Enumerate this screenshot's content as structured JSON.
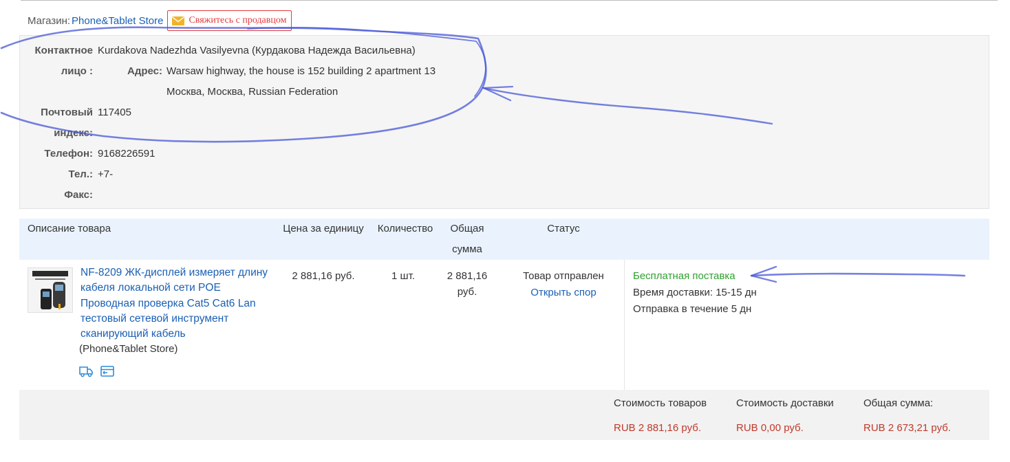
{
  "store": {
    "label": "Магазин:",
    "name": "Phone&Tablet Store",
    "contact_button": "Свяжитесь с продавцом"
  },
  "address": {
    "contact_label_1": "Контактное",
    "contact_label_2": "лицо :",
    "contact_value": "Kurdakova Nadezhda Vasilyevna (Курдакова Надежда Васильевна)",
    "address_label": "Адрес:",
    "address_line1": "Warsaw highway, the house is 152 building 2 apartment 13",
    "address_line2": "Москва, Москва, Russian Federation",
    "postal_label_1": "Почтовый",
    "postal_label_2": "индекс:",
    "postal_value": "117405",
    "phone_label": "Телефон:",
    "phone_value": "9168226591",
    "tel_label": "Тел.:",
    "tel_value": "+7-",
    "fax_label": "Факс:",
    "fax_value": ""
  },
  "table": {
    "headers": {
      "description": "Описание товара",
      "unit_price": "Цена за единицу",
      "quantity": "Количество",
      "total_1": "Общая",
      "total_2": "сумма",
      "status": "Статус"
    },
    "row": {
      "title": "NF-8209 ЖК-дисплей измеряет длину кабеля локальной сети POE Проводная проверка Cat5 Cat6 Lan тестовый сетевой инструмент сканирующий кабель",
      "store": "(Phone&Tablet Store)",
      "unit_price": "2 881,16 руб.",
      "quantity": "1 шт.",
      "total_1": "2 881,16",
      "total_2": "руб.",
      "status": "Товар отправлен",
      "dispute_link": "Открыть спор",
      "shipping_free": "Бесплатная поставка",
      "delivery_label": "Время доставки:",
      "delivery_value": "15-15 дн",
      "dispatch_label": "Отправка в течение",
      "dispatch_value": "5 дн"
    }
  },
  "totals": {
    "goods_label": "Стоимость товаров",
    "goods_value": "RUB 2 881,16 руб.",
    "shipping_label": "Стоимость доставки",
    "shipping_value": "RUB 0,00 руб.",
    "total_label": "Общая сумма:",
    "total_value": "RUB 2 673,21 руб."
  },
  "colors": {
    "link": "#1a5fb4",
    "accent_red": "#e4393c",
    "price_red": "#c0392b",
    "success_green": "#2ea12e",
    "header_bg": "#eaf3fd",
    "scribble": "#3344cc"
  },
  "icons": [
    "mail-icon",
    "truck-icon",
    "card-icon"
  ]
}
